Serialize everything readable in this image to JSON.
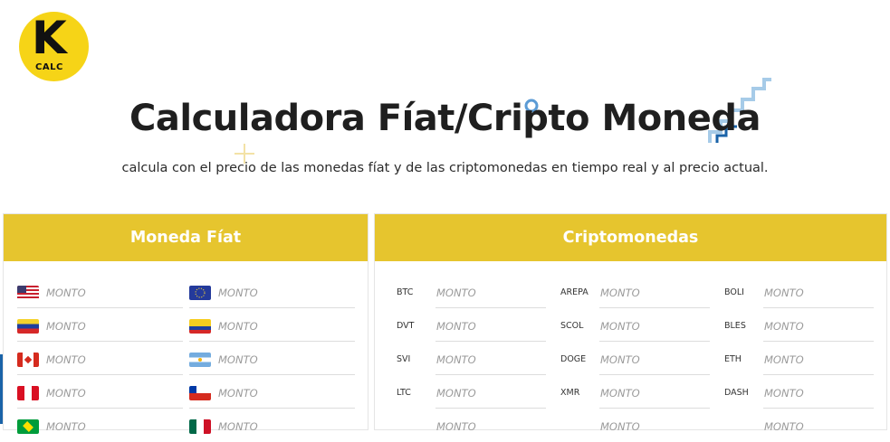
{
  "logo": {
    "letter": "K",
    "sub": "CALC",
    "color": "#f6d417"
  },
  "header": {
    "title": "Calculadora Fíat/Cripto Moneda",
    "subtitle": "calcula con el precio de las monedas fíat y de las criptomonedas en tiempo real y al precio actual."
  },
  "colors": {
    "panel_header": "#e6c52e",
    "placeholder": "#9a9a9a",
    "accent_blue": "#1a63a8"
  },
  "fiat": {
    "title": "Moneda Fíat",
    "rows": [
      [
        {
          "flag": "usa-flag",
          "placeholder": "MONTO"
        },
        {
          "flag": "eu-flag",
          "placeholder": "MONTO"
        }
      ],
      [
        {
          "flag": "venezuela-flag",
          "placeholder": "MONTO"
        },
        {
          "flag": "colombia-flag",
          "placeholder": "MONTO"
        }
      ],
      [
        {
          "flag": "canada-flag",
          "placeholder": "MONTO"
        },
        {
          "flag": "argentina-flag",
          "placeholder": "MONTO"
        }
      ],
      [
        {
          "flag": "peru-flag",
          "placeholder": "MONTO"
        },
        {
          "flag": "chile-flag",
          "placeholder": "MONTO"
        }
      ],
      [
        {
          "flag": "brazil-flag",
          "placeholder": "MONTO"
        },
        {
          "flag": "mexico-flag",
          "placeholder": "MONTO"
        }
      ]
    ]
  },
  "crypto": {
    "title": "Criptomonedas",
    "rows": [
      [
        {
          "symbol": "BTC",
          "placeholder": "MONTO"
        },
        {
          "symbol": "AREPA",
          "placeholder": "MONTO"
        },
        {
          "symbol": "BOLI",
          "placeholder": "MONTO"
        }
      ],
      [
        {
          "symbol": "DVT",
          "placeholder": "MONTO"
        },
        {
          "symbol": "SCOL",
          "placeholder": "MONTO"
        },
        {
          "symbol": "BLES",
          "placeholder": "MONTO"
        }
      ],
      [
        {
          "symbol": "SVI",
          "placeholder": "MONTO"
        },
        {
          "symbol": "DOGE",
          "placeholder": "MONTO"
        },
        {
          "symbol": "ETH",
          "placeholder": "MONTO"
        }
      ],
      [
        {
          "symbol": "LTC",
          "placeholder": "MONTO"
        },
        {
          "symbol": "XMR",
          "placeholder": "MONTO"
        },
        {
          "symbol": "DASH",
          "placeholder": "MONTO"
        }
      ],
      [
        {
          "symbol": "",
          "placeholder": "MONTO"
        },
        {
          "symbol": "",
          "placeholder": "MONTO"
        },
        {
          "symbol": "",
          "placeholder": "MONTO"
        }
      ]
    ]
  }
}
